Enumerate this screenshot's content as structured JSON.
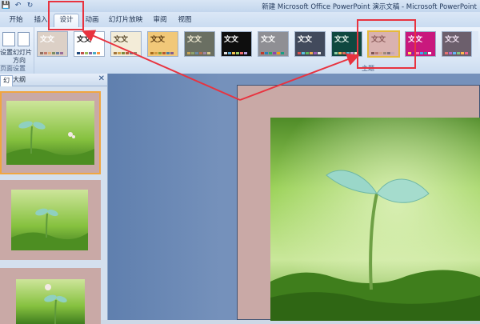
{
  "window": {
    "title": "新建 Microsoft Office PowerPoint 演示文稿 - Microsoft PowerPoint"
  },
  "qat": {
    "save": "💾",
    "undo": "↶",
    "redo": "↻"
  },
  "tabs": [
    "开始",
    "插入",
    "设计",
    "动画",
    "幻灯片放映",
    "审阅",
    "视图"
  ],
  "active_tab": "设计",
  "ribbon": {
    "page_setup_label": "设置",
    "slide_orientation_label": "幻灯片",
    "direction_label": "方向",
    "group_label_page": "页面设置",
    "group_label_themes": "主题"
  },
  "themes": [
    {
      "text": "文文",
      "bg": "#dcd0c6",
      "fg": "#ffffff",
      "sw": [
        "#8e6f62",
        "#c57b6b",
        "#e2b37d",
        "#7c8e64",
        "#6a7ea0",
        "#9a6e9a"
      ]
    },
    {
      "text": "文文",
      "bg": "#ffffff",
      "fg": "#1b1b1b",
      "sw": [
        "#1f497d",
        "#c0504d",
        "#9bbb59",
        "#8064a2",
        "#4bacc6",
        "#f79646"
      ]
    },
    {
      "text": "文文",
      "bg": "#f3ecd8",
      "fg": "#5a4a2d",
      "sw": [
        "#a0743b",
        "#d2a44a",
        "#7e8a3c",
        "#b35d3a",
        "#6c7d8c",
        "#9b8467"
      ]
    },
    {
      "text": "文文",
      "bg": "#f1c879",
      "fg": "#5c3b12",
      "sw": [
        "#a66b1c",
        "#d49b3f",
        "#7f9a36",
        "#b8582d",
        "#4e7da0",
        "#83608e"
      ]
    },
    {
      "text": "文文",
      "bg": "#6a6f62",
      "fg": "#f0ead2",
      "sw": [
        "#c9a554",
        "#8fa36b",
        "#6b8aa6",
        "#b7704f",
        "#9c86a5",
        "#d9c98c"
      ]
    },
    {
      "text": "文文",
      "bg": "#0e0e0e",
      "fg": "#ffffff",
      "sw": [
        "#e0e0e0",
        "#5fa8d3",
        "#f2c14e",
        "#9ccc65",
        "#ef6c6c",
        "#b39ddb"
      ]
    },
    {
      "text": "文文",
      "bg": "#8f8f94",
      "fg": "#ffffff",
      "sw": [
        "#c0392b",
        "#2980b9",
        "#27ae60",
        "#8e44ad",
        "#f39c12",
        "#16a085"
      ]
    },
    {
      "text": "文文",
      "bg": "#424a5c",
      "fg": "#ffffff",
      "sw": [
        "#d9534f",
        "#5bc0de",
        "#5cb85c",
        "#f0ad4e",
        "#9b59b6",
        "#e5e5e5"
      ]
    },
    {
      "text": "文文",
      "bg": "#0f4840",
      "fg": "#e9f6ef",
      "sw": [
        "#8fd3a8",
        "#f2b65c",
        "#e06c5c",
        "#5cb8d6",
        "#c8a2d8",
        "#f4f0c8"
      ]
    },
    {
      "text": "文文",
      "bg": "#d9b2b0",
      "fg": "#8a5b5a",
      "sw": [
        "#7f5554",
        "#b87b74",
        "#d3a58d",
        "#9f8a7b",
        "#80727a",
        "#c7a7b4"
      ]
    },
    {
      "text": "文文",
      "bg": "#c9187d",
      "fg": "#ffffff",
      "sw": [
        "#ffdd57",
        "#8e24aa",
        "#ff80ab",
        "#42a5f5",
        "#26a69a",
        "#ffffff"
      ]
    },
    {
      "text": "文文",
      "bg": "#6c5f6c",
      "fg": "#f5e6f5",
      "sw": [
        "#e57373",
        "#ba68c8",
        "#64b5f6",
        "#81c784",
        "#ffb74d",
        "#f06292"
      ]
    }
  ],
  "selected_theme_index": 9,
  "left_pane": {
    "tab_slides": "幻",
    "tab_outline": "大纲",
    "close": "✕"
  },
  "colors": {
    "callout": "#e8333f",
    "slide_bg": "#c9a9a6",
    "thumb_selected": "#f0a640"
  }
}
